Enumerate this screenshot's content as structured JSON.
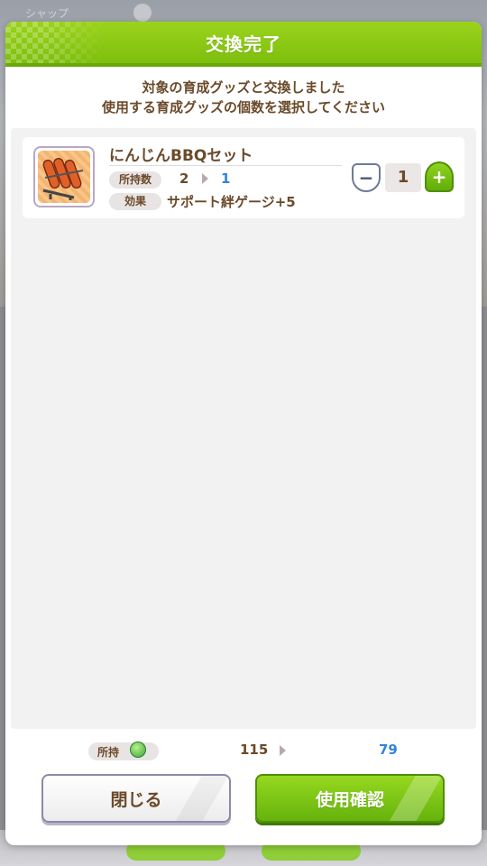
{
  "background": {
    "top_label": "シャップ"
  },
  "dialog": {
    "title": "交換完了",
    "message_line1": "対象の育成グッズと交換しました",
    "message_line2": "使用する育成グッズの個数を選択してください"
  },
  "item": {
    "name": "にんじんBBQセット",
    "owned_label": "所持数",
    "owned_from": "2",
    "owned_to": "1",
    "effect_label": "効果",
    "effect_text": "サポート絆ゲージ+5",
    "icon": "carrot-bbq-icon"
  },
  "stepper": {
    "minus": "−",
    "value": "1",
    "plus": "+"
  },
  "currency": {
    "label": "所持",
    "icon": "coin-icon",
    "from": "115",
    "to": "79"
  },
  "buttons": {
    "close": "閉じる",
    "confirm": "使用確認"
  },
  "colors": {
    "accent_green": "#7dbf0d",
    "text_brown": "#6b4a2a",
    "value_blue": "#2f86d8"
  }
}
